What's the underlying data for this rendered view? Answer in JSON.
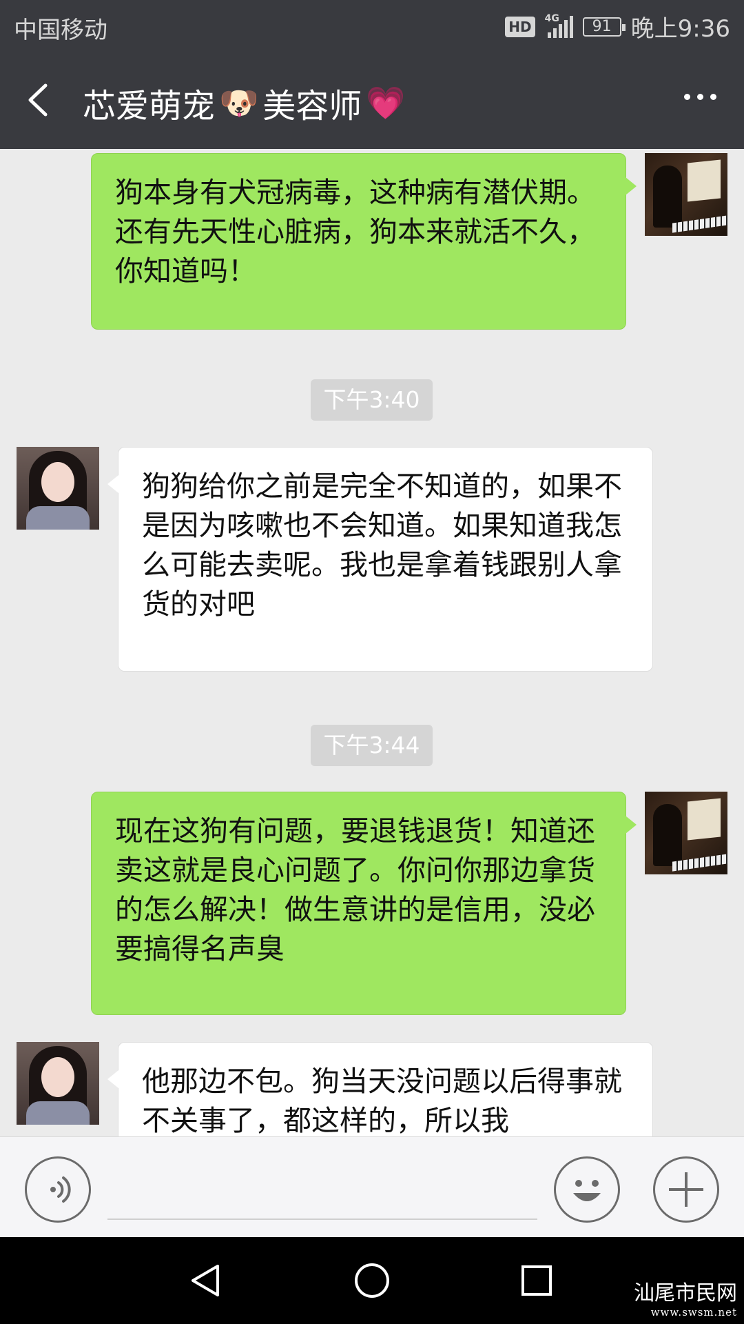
{
  "status_bar": {
    "carrier": "中国移动",
    "hd": "HD",
    "network": "4G",
    "battery": "91",
    "time": "晚上9:36"
  },
  "header": {
    "title_part1": "芯爱萌宠",
    "dog_emoji": "🐶",
    "title_part2": "美容师",
    "heart_emoji": "💗",
    "back_icon": "chevron-left-icon",
    "more_icon": "more-dots-icon"
  },
  "messages": [
    {
      "side": "right",
      "text": "狗本身有犬冠病毒，这种病有潜伏期。还有先天性心脏病，狗本来就活不久，你知道吗！"
    },
    {
      "type": "timestamp",
      "text": "下午3:40"
    },
    {
      "side": "left",
      "text": "狗狗给你之前是完全不知道的，如果不是因为咳嗽也不会知道。如果知道我怎么可能去卖呢。我也是拿着钱跟别人拿货的对吧"
    },
    {
      "type": "timestamp",
      "text": "下午3:44"
    },
    {
      "side": "right",
      "text": "现在这狗有问题，要退钱退货！知道还卖这就是良心问题了。你问你那边拿货的怎么解决！做生意讲的是信用，没必要搞得名声臭"
    },
    {
      "side": "left",
      "text": "他那边不包。狗当天没问题以后得事就不关事了，都这样的，所以我"
    }
  ],
  "input_bar": {
    "voice_icon": "voice-icon",
    "emoji_icon": "emoji-icon",
    "plus_icon": "plus-icon"
  },
  "nav_bar": {
    "back_icon": "triangle-back-icon",
    "home_icon": "circle-home-icon",
    "recents_icon": "square-recents-icon"
  },
  "watermark": {
    "text": "汕尾市民网",
    "url": "www.swsm.net"
  },
  "colors": {
    "header_bg": "#393a3f",
    "chat_bg": "#ebebeb",
    "sent_bubble": "#9fe760",
    "received_bubble": "#ffffff",
    "timestamp_bg": "#d5d5d5"
  }
}
